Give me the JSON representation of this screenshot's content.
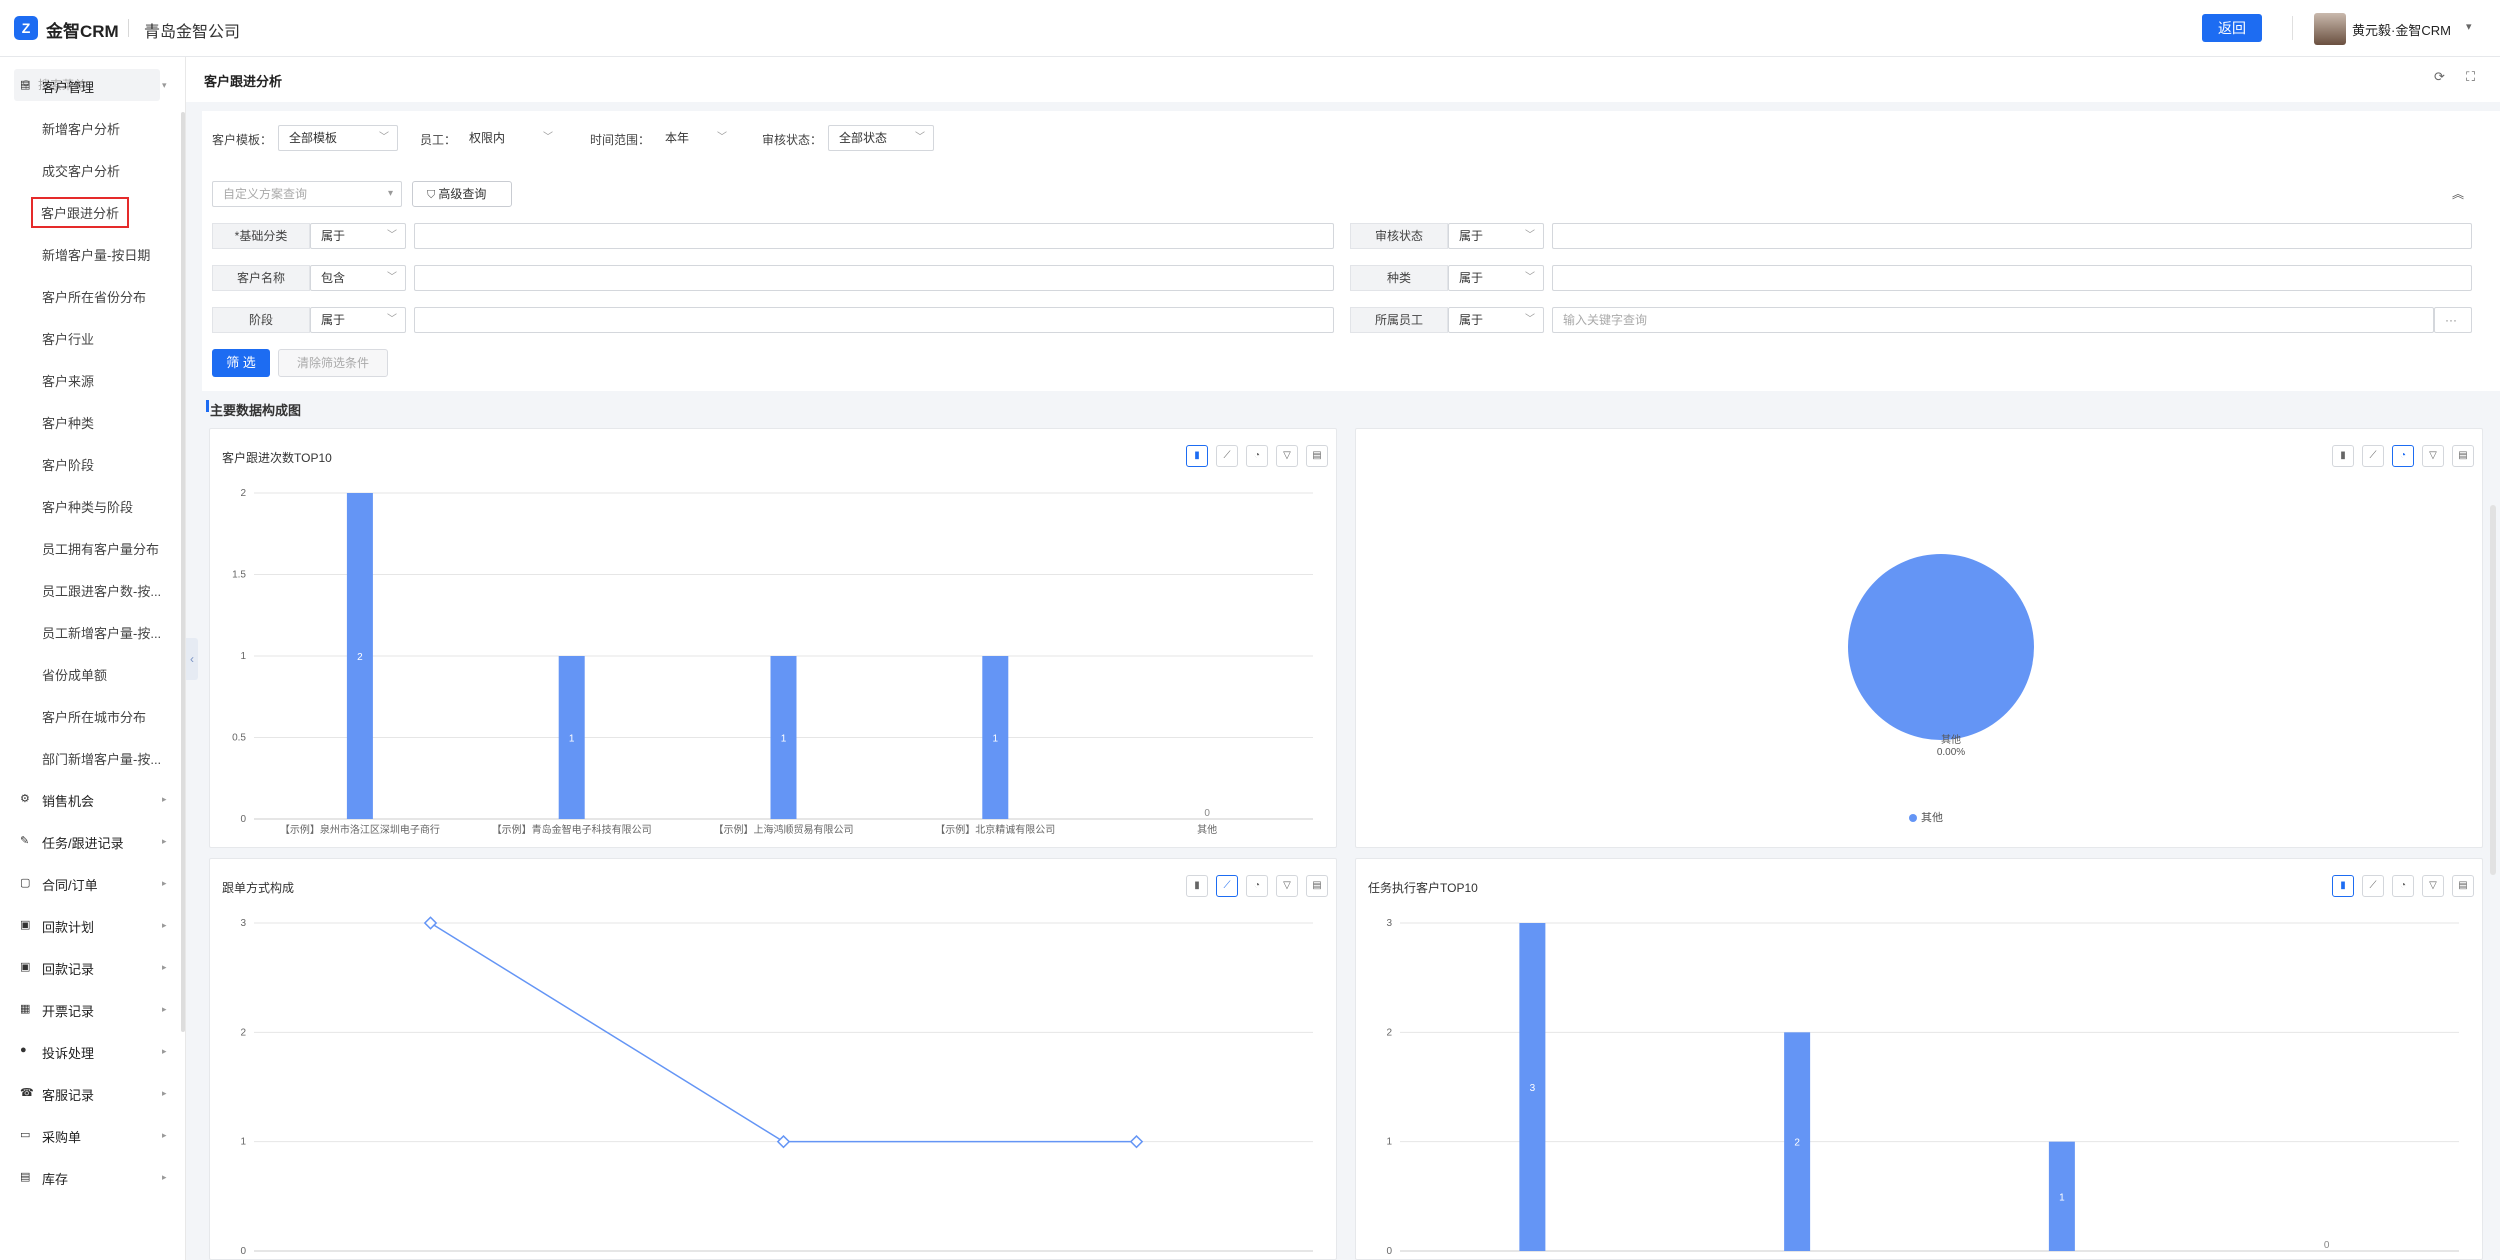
{
  "app": {
    "logo_mark": "Z",
    "logo_text": "金智CRM",
    "company": "青岛金智公司"
  },
  "header": {
    "back_label": "返回",
    "user": "黄元毅·金智CRM",
    "user_caret": "▾"
  },
  "sidebar": {
    "search_placeholder": "搜索菜单",
    "groups": [
      {
        "label": "客户管理",
        "icon": "▤",
        "open": true,
        "items": [
          "新增客户分析",
          "成交客户分析",
          "客户跟进分析",
          "新增客户量-按日期",
          "客户所在省份分布",
          "客户行业",
          "客户来源",
          "客户种类",
          "客户阶段",
          "客户种类与阶段",
          "员工拥有客户量分布",
          "员工跟进客户数-按...",
          "员工新增客户量-按...",
          "省份成单额",
          "客户所在城市分布",
          "部门新增客户量-按..."
        ]
      },
      {
        "label": "销售机会",
        "icon": "⚙"
      },
      {
        "label": "任务/跟进记录",
        "icon": "✎"
      },
      {
        "label": "合同/订单",
        "icon": "▢"
      },
      {
        "label": "回款计划",
        "icon": "▣"
      },
      {
        "label": "回款记录",
        "icon": "▣"
      },
      {
        "label": "开票记录",
        "icon": "▦"
      },
      {
        "label": "投诉处理",
        "icon": "●"
      },
      {
        "label": "客服记录",
        "icon": "☎"
      },
      {
        "label": "采购单",
        "icon": "▭"
      },
      {
        "label": "库存",
        "icon": "▤"
      }
    ]
  },
  "page": {
    "title": "客户跟进分析",
    "section_title": "主要数据构成图"
  },
  "filters": {
    "template_label": "客户模板：",
    "template_value": "全部模板",
    "employee_label": "员工：",
    "employee_value": "权限内",
    "time_label": "时间范围：",
    "time_value": "本年",
    "audit_label": "审核状态：",
    "audit_value": "全部状态",
    "custom_placeholder": "自定义方案查询",
    "advanced_label": "高级查询",
    "conditions": [
      {
        "label": "*基础分类",
        "op": "属于",
        "value": ""
      },
      {
        "label": "审核状态",
        "op": "属于",
        "value": ""
      },
      {
        "label": "客户名称",
        "op": "包含",
        "value": ""
      },
      {
        "label": "种类",
        "op": "属于",
        "value": ""
      },
      {
        "label": "阶段",
        "op": "属于",
        "value": ""
      },
      {
        "label": "所属员工",
        "op": "属于",
        "placeholder": "输入关键字查询"
      }
    ],
    "filter_btn": "筛 选",
    "clear_btn": "清除筛选条件",
    "more_btn": "···",
    "collapse_icon": "︽"
  },
  "chart_data": [
    {
      "type": "bar",
      "title": "客户跟进次数TOP10",
      "categories": [
        "【示例】泉州市洛江区深圳电子商行",
        "【示例】青岛金智电子科技有限公司",
        "【示例】上海鸿顺贸易有限公司",
        "【示例】北京精诚有限公司",
        "其他"
      ],
      "values": [
        2,
        1,
        1,
        1,
        0
      ],
      "ylim": [
        0,
        2
      ],
      "yticks": [
        "0",
        "0.5",
        "1",
        "1.5",
        "2"
      ],
      "grid": true
    },
    {
      "type": "pie",
      "title": "",
      "slices": [
        {
          "name": "其他",
          "value": 100,
          "label": "其他",
          "pct": "0.00%"
        }
      ],
      "legend": "bottom",
      "color": "#6495f5"
    },
    {
      "type": "line",
      "title": "跟单方式构成",
      "categories": [
        "",
        "",
        ""
      ],
      "values": [
        3,
        1,
        1
      ],
      "ylim": [
        0,
        3
      ],
      "yticks": [
        "0",
        "1",
        "2",
        "3"
      ],
      "grid": true
    },
    {
      "type": "bar",
      "title": "任务执行客户TOP10",
      "categories": [
        "",
        "",
        "",
        ""
      ],
      "values": [
        3,
        2,
        1,
        0
      ],
      "ylim": [
        0,
        3
      ],
      "yticks": [
        "0",
        "1",
        "2",
        "3"
      ],
      "grid": true
    }
  ],
  "colors": {
    "accent": "#1d6cf2",
    "series": "#6495f5",
    "active_border": "#e52a2a"
  }
}
